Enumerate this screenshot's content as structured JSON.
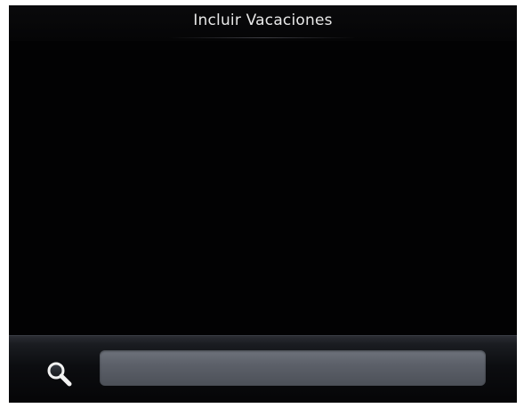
{
  "header": {
    "title": "Incluir Vacaciones"
  },
  "search": {
    "value": "",
    "placeholder": "",
    "icon": "search-icon"
  },
  "colors": {
    "background": "#020203",
    "title_text": "#e8e8e8",
    "field": "#5c6069"
  }
}
